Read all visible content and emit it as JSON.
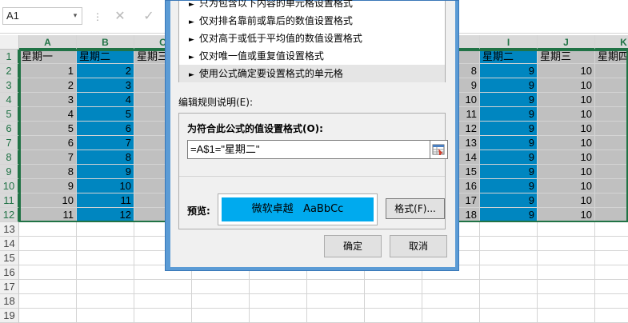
{
  "formula_bar": {
    "name_box": "A1",
    "name_box_arrow": "▾",
    "separator": "⋮",
    "cancel_glyph": "✕",
    "confirm_glyph": "✓"
  },
  "grid": {
    "columns": [
      "A",
      "B",
      "C",
      "I",
      "J",
      "K"
    ],
    "row_numbers": [
      "1",
      "2",
      "3",
      "4",
      "5",
      "6",
      "7",
      "8",
      "9",
      "10",
      "11",
      "12",
      "13",
      "14",
      "15",
      "16",
      "17",
      "18",
      "19"
    ],
    "rows": [
      [
        "星期一",
        "星期二",
        "星期三",
        "星期二",
        "星期三",
        "星期四"
      ],
      [
        "1",
        "2",
        "",
        "9",
        "10",
        ""
      ],
      [
        "2",
        "3",
        "",
        "9",
        "10",
        ""
      ],
      [
        "3",
        "4",
        "",
        "9",
        "10",
        ""
      ],
      [
        "4",
        "5",
        "",
        "9",
        "10",
        ""
      ],
      [
        "5",
        "6",
        "",
        "9",
        "10",
        ""
      ],
      [
        "6",
        "7",
        "",
        "9",
        "10",
        ""
      ],
      [
        "7",
        "8",
        "",
        "9",
        "10",
        ""
      ],
      [
        "8",
        "9",
        "",
        "9",
        "10",
        ""
      ],
      [
        "9",
        "10",
        "",
        "9",
        "10",
        ""
      ],
      [
        "10",
        "11",
        "",
        "9",
        "10",
        ""
      ],
      [
        "11",
        "12",
        "",
        "9",
        "10",
        ""
      ]
    ],
    "hidden_h_values": [
      "8",
      "9",
      "10",
      "11",
      "12",
      "13",
      "14",
      "15",
      "16",
      "17",
      "18"
    ]
  },
  "dialog": {
    "rule_types": [
      "只为包含以下内容的单元格设置格式",
      "仅对排名靠前或靠后的数值设置格式",
      "仅对高于或低于平均值的数值设置格式",
      "仅对唯一值或重复值设置格式",
      "使用公式确定要设置格式的单元格"
    ],
    "rule_arrow": "►",
    "edit_rule_label": "编辑规则说明(E):",
    "formula_label": "为符合此公式的值设置格式(O):",
    "formula_value": "=A$1=\"星期二\"",
    "preview_label": "预览:",
    "preview_text": "微软卓越   AaBbCc",
    "format_button": "格式(F)...",
    "ok_button": "确定",
    "cancel_button": "取消"
  },
  "colors": {
    "gray_fill": "#c0c0c0",
    "blue_fill": "#0086c0",
    "preview_fill": "#00aaee",
    "selection_border": "#217346",
    "dialog_frame": "#5b9bd5"
  }
}
